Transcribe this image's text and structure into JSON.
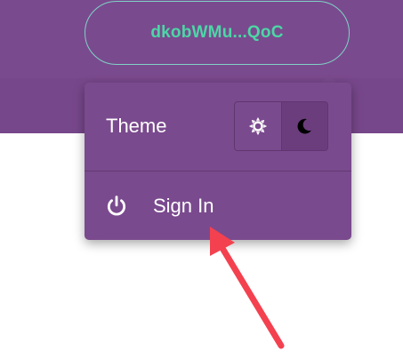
{
  "wallet": {
    "address_short": "dkobWMu...QoC",
    "accent_color": "#4cd7a6"
  },
  "menu": {
    "theme_label": "Theme",
    "theme_options": [
      {
        "name": "light",
        "icon": "sun-icon"
      },
      {
        "name": "dark",
        "icon": "moon-icon",
        "selected": true
      }
    ],
    "signin_label": "Sign In",
    "signin_icon": "power-icon"
  },
  "colors": {
    "header_bg": "#7a4a8e",
    "annotation_arrow": "#f4414f"
  }
}
